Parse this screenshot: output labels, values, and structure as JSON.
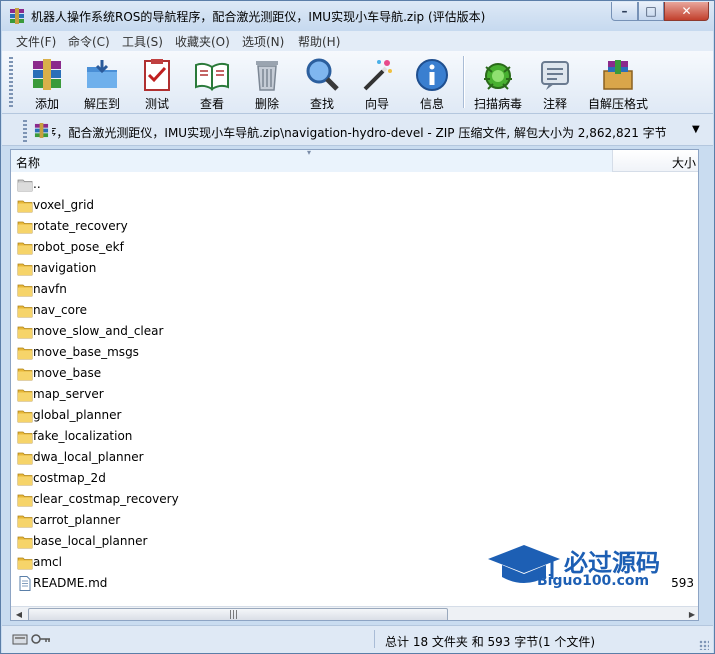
{
  "title": "机器人操作系统ROS的导航程序，配合激光测距仪，IMU实现小车导航.zip (评估版本)",
  "window_buttons": {
    "minimize": "–",
    "maximize": "□",
    "close": "✕"
  },
  "menu": [
    "文件(F)",
    "命令(C)",
    "工具(S)",
    "收藏夹(O)",
    "选项(N)",
    "帮助(H)"
  ],
  "toolbar": [
    {
      "label": "添加",
      "icon": "add-archive-icon"
    },
    {
      "label": "解压到",
      "icon": "extract-to-icon"
    },
    {
      "label": "测试",
      "icon": "test-icon"
    },
    {
      "label": "查看",
      "icon": "view-icon"
    },
    {
      "label": "删除",
      "icon": "delete-icon"
    },
    {
      "label": "查找",
      "icon": "find-icon"
    },
    {
      "label": "向导",
      "icon": "wizard-icon"
    },
    {
      "label": "信息",
      "icon": "info-icon"
    },
    {
      "label": "扫描病毒",
      "icon": "virus-scan-icon"
    },
    {
      "label": "注释",
      "icon": "comment-icon"
    },
    {
      "label": "自解压格式",
      "icon": "sfx-icon"
    }
  ],
  "address": "机器人操作系统ROS的导航程序，配合激光测距仪，IMU实现小车导航.zip\\navigation-hydro-devel - ZIP 压缩文件, 解包大小为 2,862,821 字节",
  "columns": {
    "name": "名称",
    "size": "大小"
  },
  "files": [
    {
      "name": "..",
      "type": "parent",
      "size": ""
    },
    {
      "name": "voxel_grid",
      "type": "folder",
      "size": ""
    },
    {
      "name": "rotate_recovery",
      "type": "folder",
      "size": ""
    },
    {
      "name": "robot_pose_ekf",
      "type": "folder",
      "size": ""
    },
    {
      "name": "navigation",
      "type": "folder",
      "size": ""
    },
    {
      "name": "navfn",
      "type": "folder",
      "size": ""
    },
    {
      "name": "nav_core",
      "type": "folder",
      "size": ""
    },
    {
      "name": "move_slow_and_clear",
      "type": "folder",
      "size": ""
    },
    {
      "name": "move_base_msgs",
      "type": "folder",
      "size": ""
    },
    {
      "name": "move_base",
      "type": "folder",
      "size": ""
    },
    {
      "name": "map_server",
      "type": "folder",
      "size": ""
    },
    {
      "name": "global_planner",
      "type": "folder",
      "size": ""
    },
    {
      "name": "fake_localization",
      "type": "folder",
      "size": ""
    },
    {
      "name": "dwa_local_planner",
      "type": "folder",
      "size": ""
    },
    {
      "name": "costmap_2d",
      "type": "folder",
      "size": ""
    },
    {
      "name": "clear_costmap_recovery",
      "type": "folder",
      "size": ""
    },
    {
      "name": "carrot_planner",
      "type": "folder",
      "size": ""
    },
    {
      "name": "base_local_planner",
      "type": "folder",
      "size": ""
    },
    {
      "name": "amcl",
      "type": "folder",
      "size": ""
    },
    {
      "name": "README.md",
      "type": "file",
      "size": "593"
    }
  ],
  "watermark": {
    "main": "必过源码",
    "sub": "Biguo100.com"
  },
  "status": "总计 18 文件夹 和 593 字节(1 个文件)",
  "colors": {
    "accent": "#1d5fb4",
    "frame": "#c9dcf0"
  }
}
